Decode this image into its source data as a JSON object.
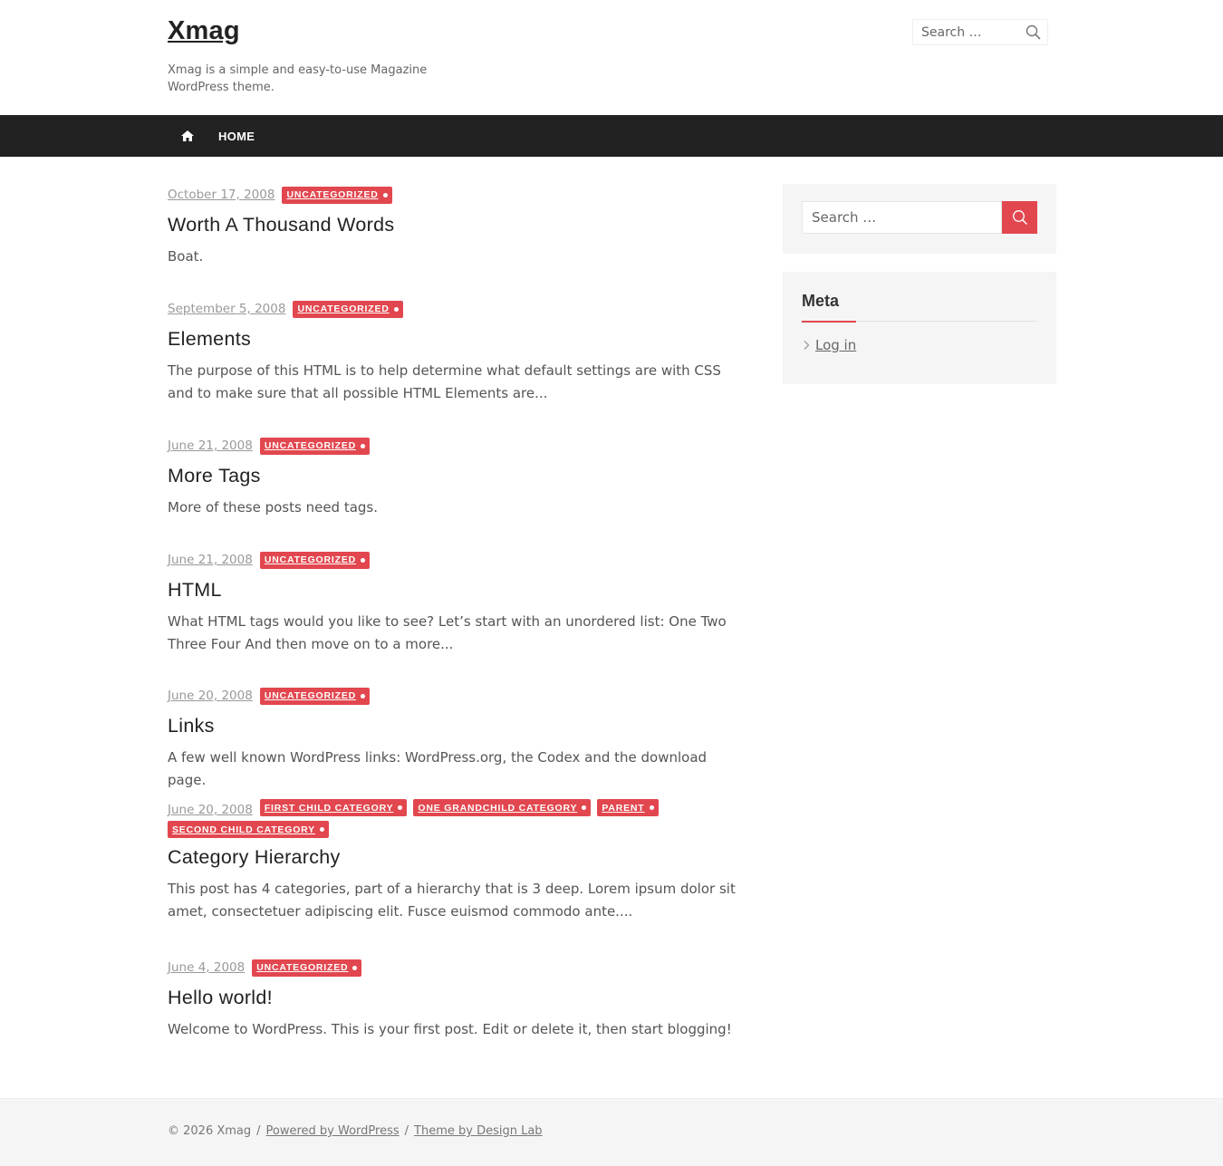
{
  "header": {
    "site_title": "Xmag",
    "site_description": "Xmag is a simple and easy-to-use Magazine WordPress theme.",
    "search_placeholder": "Search …"
  },
  "nav": {
    "home_label": "HOME"
  },
  "posts": [
    {
      "date": "October 17, 2008",
      "categories": [
        "UNCATEGORIZED"
      ],
      "title": "Worth A Thousand Words",
      "excerpt": "Boat."
    },
    {
      "date": "September 5, 2008",
      "categories": [
        "UNCATEGORIZED"
      ],
      "title": "Elements",
      "excerpt": "The purpose of this HTML is to help determine what default settings are with CSS and to make sure that all possible HTML Elements are..."
    },
    {
      "date": "June 21, 2008",
      "categories": [
        "UNCATEGORIZED"
      ],
      "title": "More Tags",
      "excerpt": "More of these posts need tags."
    },
    {
      "date": "June 21, 2008",
      "categories": [
        "UNCATEGORIZED"
      ],
      "title": "HTML",
      "excerpt": "What HTML tags would you like to see? Let’s start with an unordered list: One Two Three Four And then move on to a more..."
    },
    {
      "date": "June 20, 2008",
      "categories": [
        "UNCATEGORIZED"
      ],
      "title": "Links",
      "excerpt": "A few well known WordPress links: WordPress.org, the Codex and the download page."
    },
    {
      "date": "June 20, 2008",
      "categories": [
        "FIRST CHILD CATEGORY",
        "ONE GRANDCHILD CATEGORY",
        "PARENT",
        "SECOND CHILD CATEGORY"
      ],
      "title": "Category Hierarchy",
      "excerpt": "This post has 4 categories, part of a hierarchy that is 3 deep. Lorem ipsum dolor sit amet, consectetuer adipiscing elit. Fusce euismod commodo ante...."
    },
    {
      "date": "June 4, 2008",
      "categories": [
        "UNCATEGORIZED"
      ],
      "title": "Hello world!",
      "excerpt": "Welcome to WordPress. This is your first post. Edit or delete it, then start blogging!"
    }
  ],
  "sidebar": {
    "search_placeholder": "Search …",
    "meta_title": "Meta",
    "meta_items": [
      "Log in"
    ]
  },
  "footer": {
    "copyright": "© 2026 Xmag",
    "separator": "/",
    "powered_by": "Powered by WordPress",
    "theme_by": "Theme by Design Lab"
  },
  "colors": {
    "accent": "#e2474f",
    "nav_background": "#222222",
    "widget_background": "#f5f5f5"
  }
}
